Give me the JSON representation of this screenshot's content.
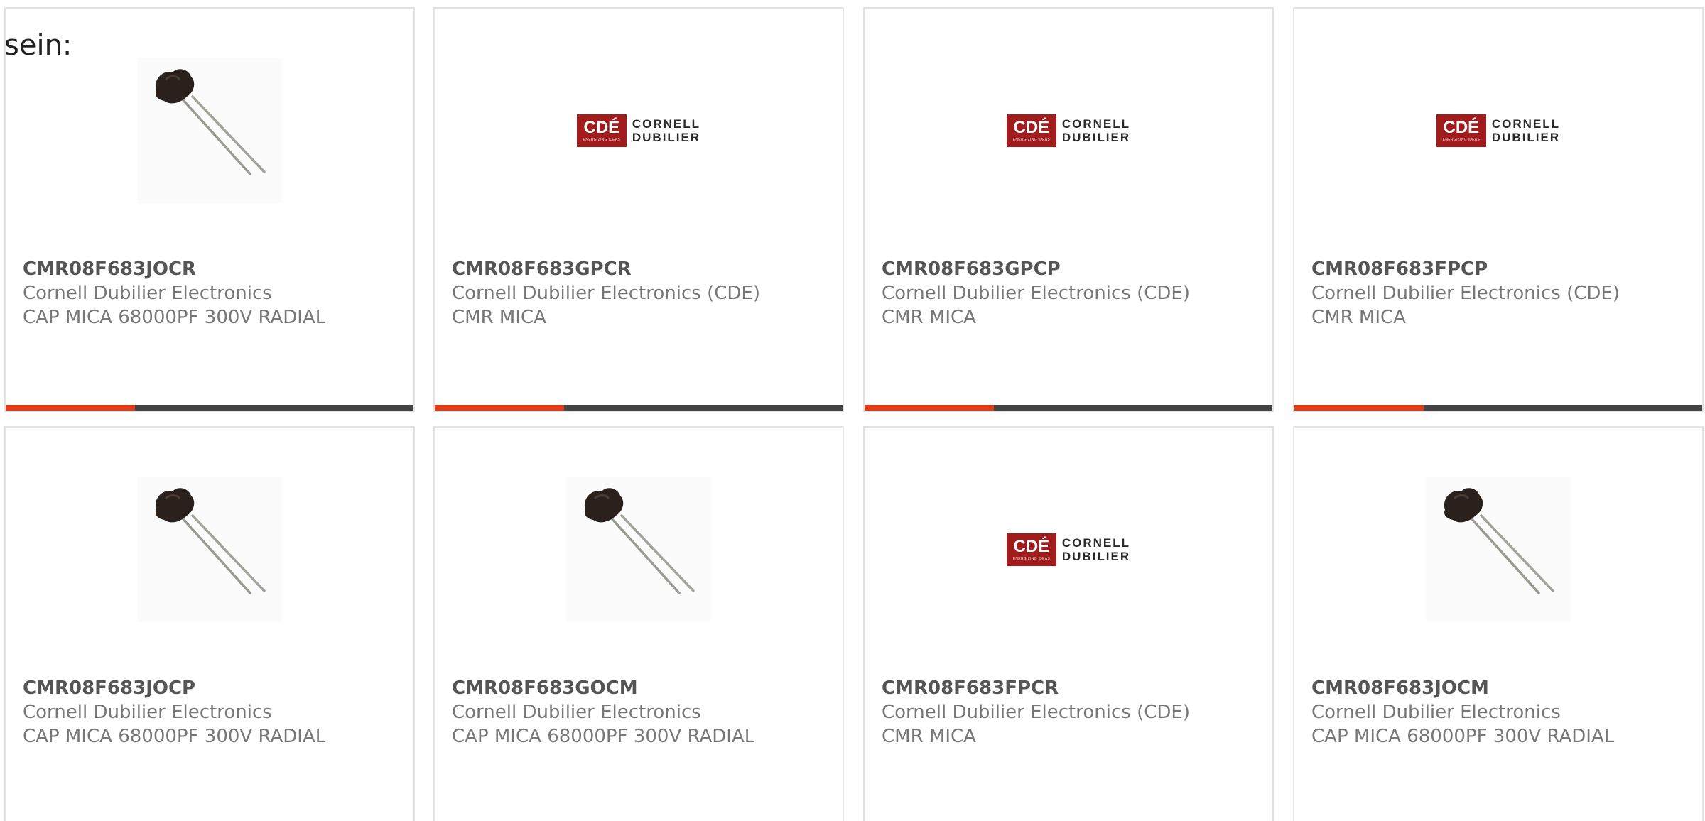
{
  "intro_text": "sein:",
  "colors": {
    "accent": "#e23c14",
    "bar": "#444444",
    "logo_red": "#a11c1c"
  },
  "products": [
    {
      "part": "CMR08F683JOCR",
      "maker": "Cornell Dubilier Electronics",
      "desc": "CAP MICA 68000PF 300V RADIAL",
      "image": "capacitor-photo"
    },
    {
      "part": "CMR08F683GPCR",
      "maker": "Cornell Dubilier Electronics (CDE)",
      "desc": "CMR MICA",
      "image": "cde-logo"
    },
    {
      "part": "CMR08F683GPCP",
      "maker": "Cornell Dubilier Electronics (CDE)",
      "desc": "CMR MICA",
      "image": "cde-logo"
    },
    {
      "part": "CMR08F683FPCP",
      "maker": "Cornell Dubilier Electronics (CDE)",
      "desc": "CMR MICA",
      "image": "cde-logo"
    },
    {
      "part": "CMR08F683JOCP",
      "maker": "Cornell Dubilier Electronics",
      "desc": "CAP MICA 68000PF 300V RADIAL",
      "image": "capacitor-photo"
    },
    {
      "part": "CMR08F683GOCM",
      "maker": "Cornell Dubilier Electronics",
      "desc": "CAP MICA 68000PF 300V RADIAL",
      "image": "capacitor-photo"
    },
    {
      "part": "CMR08F683FPCR",
      "maker": "Cornell Dubilier Electronics (CDE)",
      "desc": "CMR MICA",
      "image": "cde-logo"
    },
    {
      "part": "CMR08F683JOCM",
      "maker": "Cornell Dubilier Electronics",
      "desc": "CAP MICA 68000PF 300V RADIAL",
      "image": "capacitor-photo"
    }
  ],
  "logo": {
    "badge": "CDÉ",
    "tagline": "ENERGIZING IDEAS",
    "line1": "CORNELL",
    "line2": "DUBILIER"
  }
}
